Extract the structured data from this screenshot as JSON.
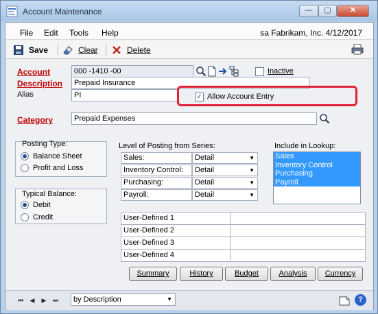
{
  "window": {
    "title": "Account Maintenance",
    "minimize_glyph": "—",
    "maximize_glyph": "▢",
    "close_glyph": "✕"
  },
  "menu": {
    "items": [
      "File",
      "Edit",
      "Tools",
      "Help"
    ],
    "company_info": "sa  Fabrikam, Inc.  4/12/2017"
  },
  "toolbar": {
    "save_label": "Save",
    "clear_label": "Clear",
    "delete_label": "Delete"
  },
  "form": {
    "account_label": "Account",
    "account_value": "000 -1410 -00",
    "inactive_label": "Inactive",
    "inactive_checked": false,
    "description_label": "Description",
    "description_value": "Prepaid Insurance",
    "alias_label": "Alias",
    "alias_value": "PI",
    "allow_entry_label": "Allow Account Entry",
    "allow_entry_checked": true,
    "category_label": "Category",
    "category_value": "Prepaid Expenses"
  },
  "posting_type": {
    "title": "Posting Type:",
    "options": [
      "Balance Sheet",
      "Profit and Loss"
    ],
    "selected": "Balance Sheet"
  },
  "typical_balance": {
    "title": "Typical Balance:",
    "options": [
      "Debit",
      "Credit"
    ],
    "selected": "Debit"
  },
  "series": {
    "title": "Level of Posting from Series:",
    "rows": [
      {
        "label": "Sales:",
        "value": "Detail"
      },
      {
        "label": "Inventory Control:",
        "value": "Detail"
      },
      {
        "label": "Purchasing:",
        "value": "Detail"
      },
      {
        "label": "Payroll:",
        "value": "Detail"
      }
    ]
  },
  "lookup": {
    "title": "Include in Lookup:",
    "items": [
      "Sales",
      "Inventory Control",
      "Purchasing",
      "Payroll"
    ]
  },
  "user_defined": {
    "labels": [
      "User-Defined 1",
      "User-Defined 2",
      "User-Defined 3",
      "User-Defined 4"
    ],
    "values": [
      "",
      "",
      "",
      ""
    ]
  },
  "buttons": {
    "summary": "Summary",
    "history": "History",
    "budget": "Budget",
    "analysis": "Analysis",
    "currency": "Currency"
  },
  "status": {
    "sort_value": "by Description",
    "help_glyph": "?"
  },
  "colors": {
    "required_label": "#c00000",
    "highlight": "#e02036",
    "selection": "#3399ff"
  }
}
